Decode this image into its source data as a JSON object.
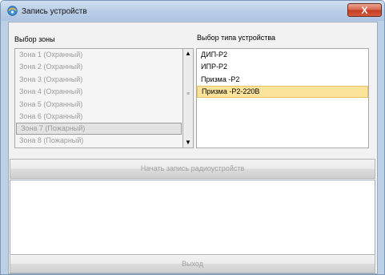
{
  "window": {
    "title": "Запись устройств",
    "close_label": "X"
  },
  "zone_section": {
    "label": "Выбор зоны",
    "items": [
      "Зона 1 (Охранный)",
      "Зона 2 (Охранный)",
      "Зона 3 (Охранный)",
      "Зона 4 (Охранный)",
      "Зона 5 (Охранный)",
      "Зона 6 (Охранный)",
      "Зона 7 (Пожарный)",
      "Зона 8 (Пожарный)"
    ],
    "selected": "Зона 7 (Пожарный)"
  },
  "device_section": {
    "label": "Выбор типа устройства",
    "items": [
      "ДИП-Р2",
      "ИПР-Р2",
      "Призма -Р2",
      "Призма -Р2-220В"
    ],
    "selected": "Призма -Р2-220В"
  },
  "buttons": {
    "start_record": "Начать запись радиоустройств",
    "exit": "Выход"
  },
  "scrollbar": {
    "up_glyph": "▲",
    "down_glyph": "▼",
    "grip_glyph": "≡"
  },
  "colors": {
    "selection_highlight": "#fbe39c",
    "disabled_text": "#9c9c9c",
    "close_button": "#c13d22"
  }
}
